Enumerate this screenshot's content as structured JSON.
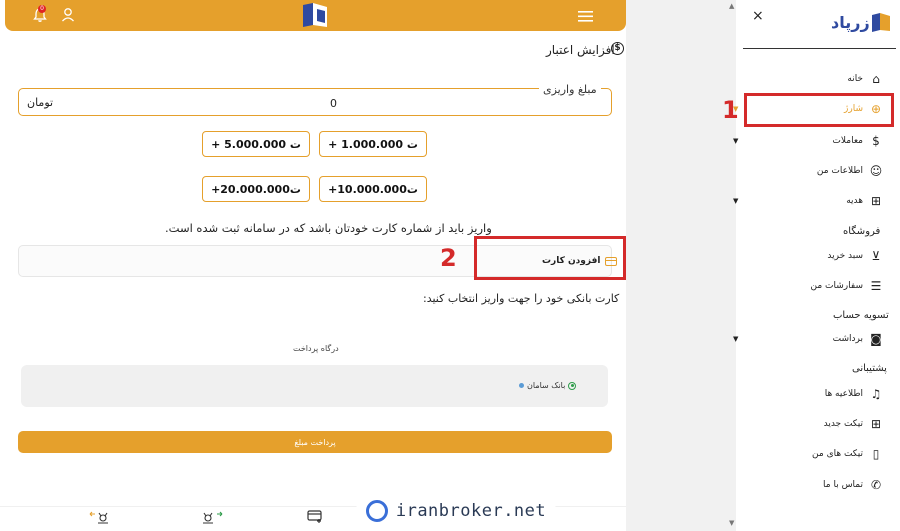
{
  "topbar": {
    "notification_count": "0",
    "accent": "#e5a02c"
  },
  "page": {
    "title": "افزایش اعتبار"
  },
  "amount": {
    "legend": "مبلغ واریزی",
    "value": "0",
    "unit": "تومان"
  },
  "presets": [
    {
      "label": "+ 1.000.000 ت"
    },
    {
      "label": "+ 5.000.000 ت"
    },
    {
      "label": "+10.000.000ت"
    },
    {
      "label": "+20.000.000ت"
    }
  ],
  "notice": "واریز باید از شماره کارت خودتان باشد که در سامانه ثبت شده است.",
  "card": {
    "add_label": "افزودن کارت"
  },
  "select_card_text": "کارت بانکی خود را جهت واریز انتخاب کنید:",
  "gateway": {
    "label": "درگاه پرداخت",
    "bank": "بانک سامان"
  },
  "pay_button": "پرداخت مبلغ",
  "watermark": "iranbroker.net",
  "sidebar": {
    "brand": "زرپاد",
    "close": "×",
    "items": [
      {
        "label": "خانه",
        "icon": "home-icon"
      },
      {
        "label": "شارژ",
        "icon": "plus-circle-icon"
      },
      {
        "label": "معاملات",
        "icon": "dollar-icon"
      },
      {
        "label": "اطلاعات من",
        "icon": "user-icon"
      },
      {
        "label": "هدیه",
        "icon": "gift-icon"
      }
    ],
    "store_heading": "فروشگاه",
    "store_items": [
      {
        "label": "سبد خرید",
        "icon": "cart-icon"
      },
      {
        "label": "سفارشات من",
        "icon": "orders-icon"
      }
    ],
    "settle_heading": "تسویه حساب",
    "settle_items": [
      {
        "label": "برداشت",
        "icon": "withdraw-icon"
      }
    ],
    "support_heading": "پشتیبانی",
    "support_items": [
      {
        "label": "اطلاعیه ها",
        "icon": "bell-icon"
      },
      {
        "label": "تیکت جدید",
        "icon": "new-ticket-icon"
      },
      {
        "label": "تیکت های من",
        "icon": "tickets-icon"
      },
      {
        "label": "تماس با ما",
        "icon": "phone-icon"
      }
    ]
  },
  "annotations": {
    "one": "1",
    "two": "2",
    "color": "#d42a2a"
  }
}
